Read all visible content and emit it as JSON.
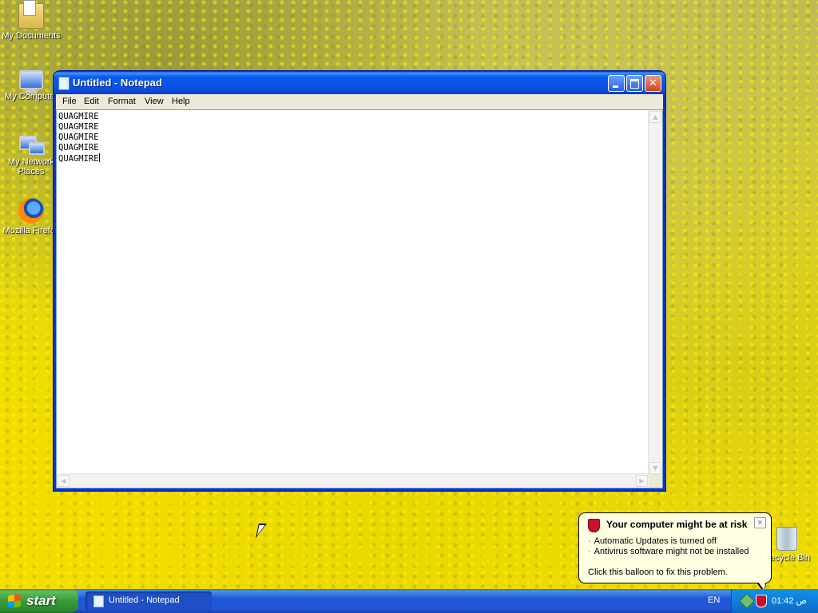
{
  "desktop": {
    "icons": [
      {
        "label": "My Documents"
      },
      {
        "label": "My Computer"
      },
      {
        "label": "My Network Places"
      },
      {
        "label": "Mozilla Firefox"
      },
      {
        "label": "Recycle Bin"
      }
    ]
  },
  "window": {
    "title": "Untitled - Notepad",
    "menu": [
      "File",
      "Edit",
      "Format",
      "View",
      "Help"
    ],
    "lines": [
      "QUAGMIRE",
      "QUAGMIRE",
      "QUAGMIRE",
      "QUAGMIRE",
      "QUAGMIRE"
    ]
  },
  "taskbar": {
    "start_label": "start",
    "task_label": "Untitled - Notepad",
    "language": "EN",
    "clock": "01:42 ص"
  },
  "balloon": {
    "title": "Your computer might be at risk",
    "lines": [
      "Automatic Updates is turned off",
      "Antivirus software might not be installed"
    ],
    "footer": "Click this balloon to fix this problem.",
    "close_glyph": "×"
  }
}
